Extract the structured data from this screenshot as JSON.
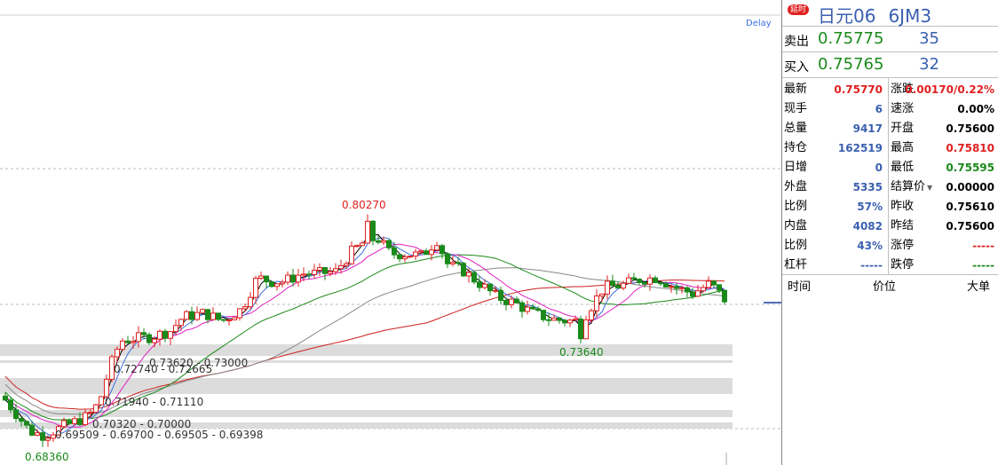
{
  "chart": {
    "delay_label": "Delay",
    "hi_label": "0.80270",
    "lo_label": "0.73640",
    "min_label": "0.68360",
    "zones": [
      "0.73620 - 0.73000",
      "0.72740 - 0.72665",
      "0.71940 - 0.71110",
      "0.70320 - 0.70000",
      "0.69509 - 0.69700 - 0.69505 - 0.69398"
    ],
    "colors": {
      "up": "#e02020",
      "down": "#1a8a1a",
      "ma5": "#000000",
      "ma10": "#3a6ee0",
      "ma20": "#e020c0",
      "ma60": "#1a8a1a",
      "ma120": "#888888",
      "ma250": "#d02020"
    }
  },
  "panel": {
    "badge": "延时",
    "name": "日元06",
    "code": "6JM3",
    "ask": {
      "label": "卖出",
      "price": "0.75775",
      "vol": "35"
    },
    "bid": {
      "label": "买入",
      "price": "0.75765",
      "vol": "32"
    },
    "left": [
      {
        "k": "最新",
        "v": "0.75770",
        "c": "red"
      },
      {
        "k": "现手",
        "v": "6",
        "c": "blue"
      },
      {
        "k": "总量",
        "v": "9417",
        "c": "blue"
      },
      {
        "k": "持仓",
        "v": "162519",
        "c": "blue"
      },
      {
        "k": "日增",
        "v": "0",
        "c": "blue"
      },
      {
        "k": "外盘",
        "v": "5335",
        "c": "blue"
      },
      {
        "k": "比例",
        "v": "57%",
        "c": "blue"
      },
      {
        "k": "内盘",
        "v": "4082",
        "c": "blue"
      },
      {
        "k": "比例",
        "v": "43%",
        "c": "blue"
      },
      {
        "k": "杠杆",
        "v": "-----",
        "c": "blue"
      }
    ],
    "right": [
      {
        "k": "涨跌",
        "v": "0.00170/0.22%",
        "c": "red"
      },
      {
        "k": "速涨",
        "v": "0.00%",
        "c": "black"
      },
      {
        "k": "开盘",
        "v": "0.75600",
        "c": "black"
      },
      {
        "k": "最高",
        "v": "0.75810",
        "c": "red"
      },
      {
        "k": "最低",
        "v": "0.75595",
        "c": "green"
      },
      {
        "k": "结算价",
        "v": "0.00000",
        "c": "black"
      },
      {
        "k": "昨收",
        "v": "0.75610",
        "c": "black"
      },
      {
        "k": "昨结",
        "v": "0.75600",
        "c": "black"
      },
      {
        "k": "涨停",
        "v": "-----",
        "c": "red"
      },
      {
        "k": "跌停",
        "v": "-----",
        "c": "green"
      }
    ],
    "footer": {
      "time": "时间",
      "price": "价位",
      "big": "大单"
    }
  }
}
